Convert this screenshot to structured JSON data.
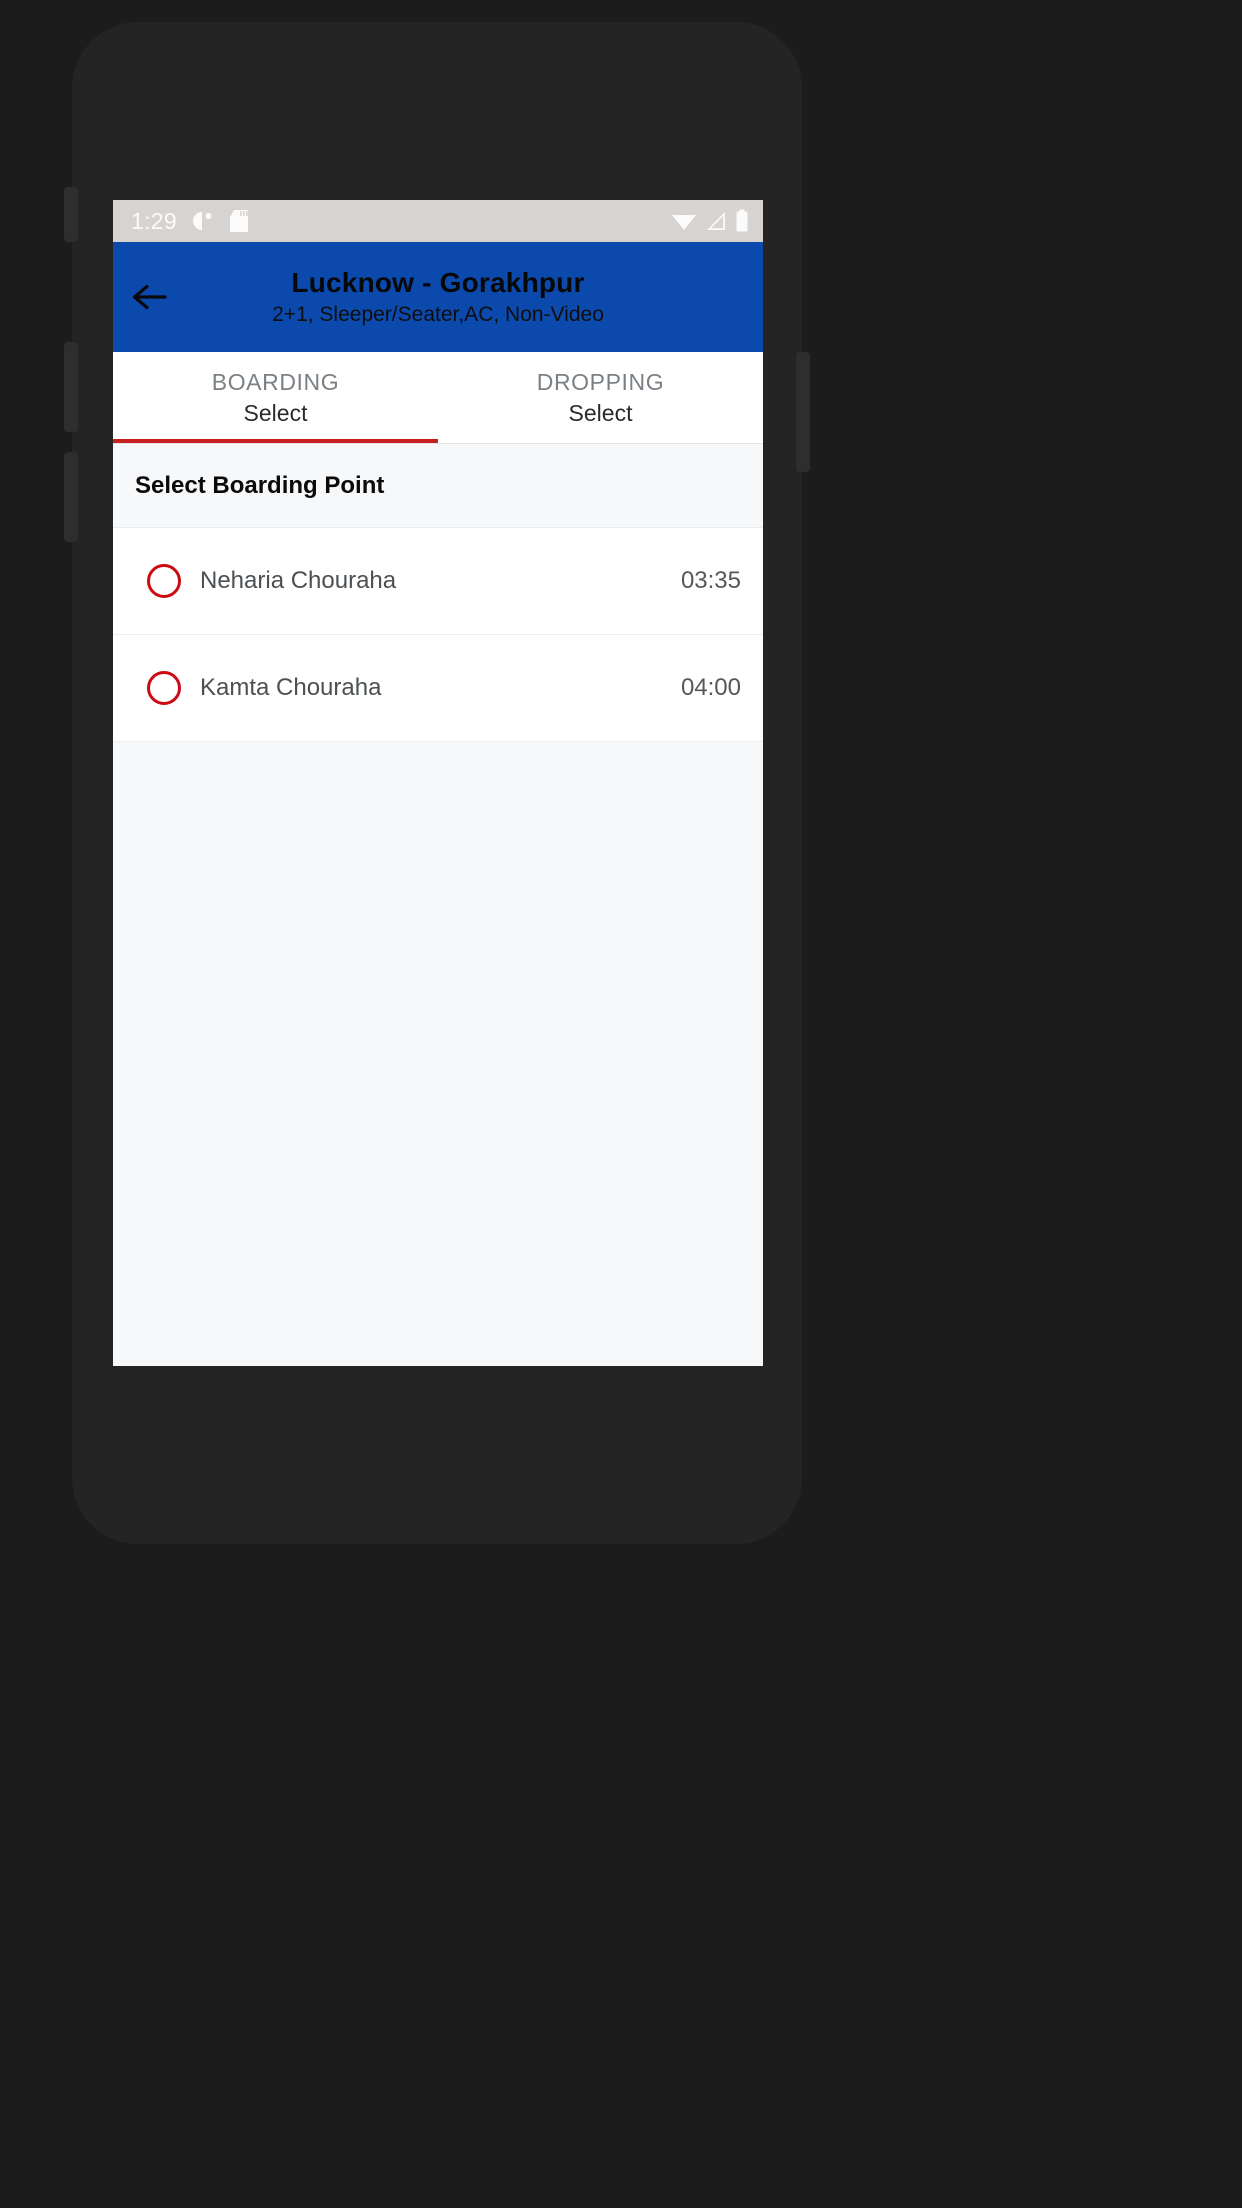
{
  "status_bar": {
    "clock": "1:29",
    "left_icons": [
      "screen-record-icon",
      "sd-card-icon"
    ],
    "right_icons": [
      "wifi-icon",
      "signal-icon",
      "battery-icon"
    ]
  },
  "app_bar": {
    "back_icon": "arrow-left-icon",
    "title": "Lucknow - Gorakhpur",
    "subtitle": "2+1, Sleeper/Seater,AC, Non-Video",
    "background_color": "#0c49ad"
  },
  "tabs": [
    {
      "head": "BOARDING",
      "value": "Select",
      "active": true
    },
    {
      "head": "DROPPING",
      "value": "Select",
      "active": false
    }
  ],
  "tab_indicator_color": "#c62020",
  "section": {
    "header": "Select Boarding Point"
  },
  "boarding_points": [
    {
      "name": "Neharia Chouraha",
      "time": "03:35",
      "selected": false
    },
    {
      "name": "Kamta Chouraha",
      "time": "04:00",
      "selected": false
    }
  ],
  "radio_color": "#cc0a13",
  "nav_bar": {
    "buttons": [
      "back-triangle-icon",
      "home-circle-icon",
      "recents-square-icon"
    ]
  }
}
